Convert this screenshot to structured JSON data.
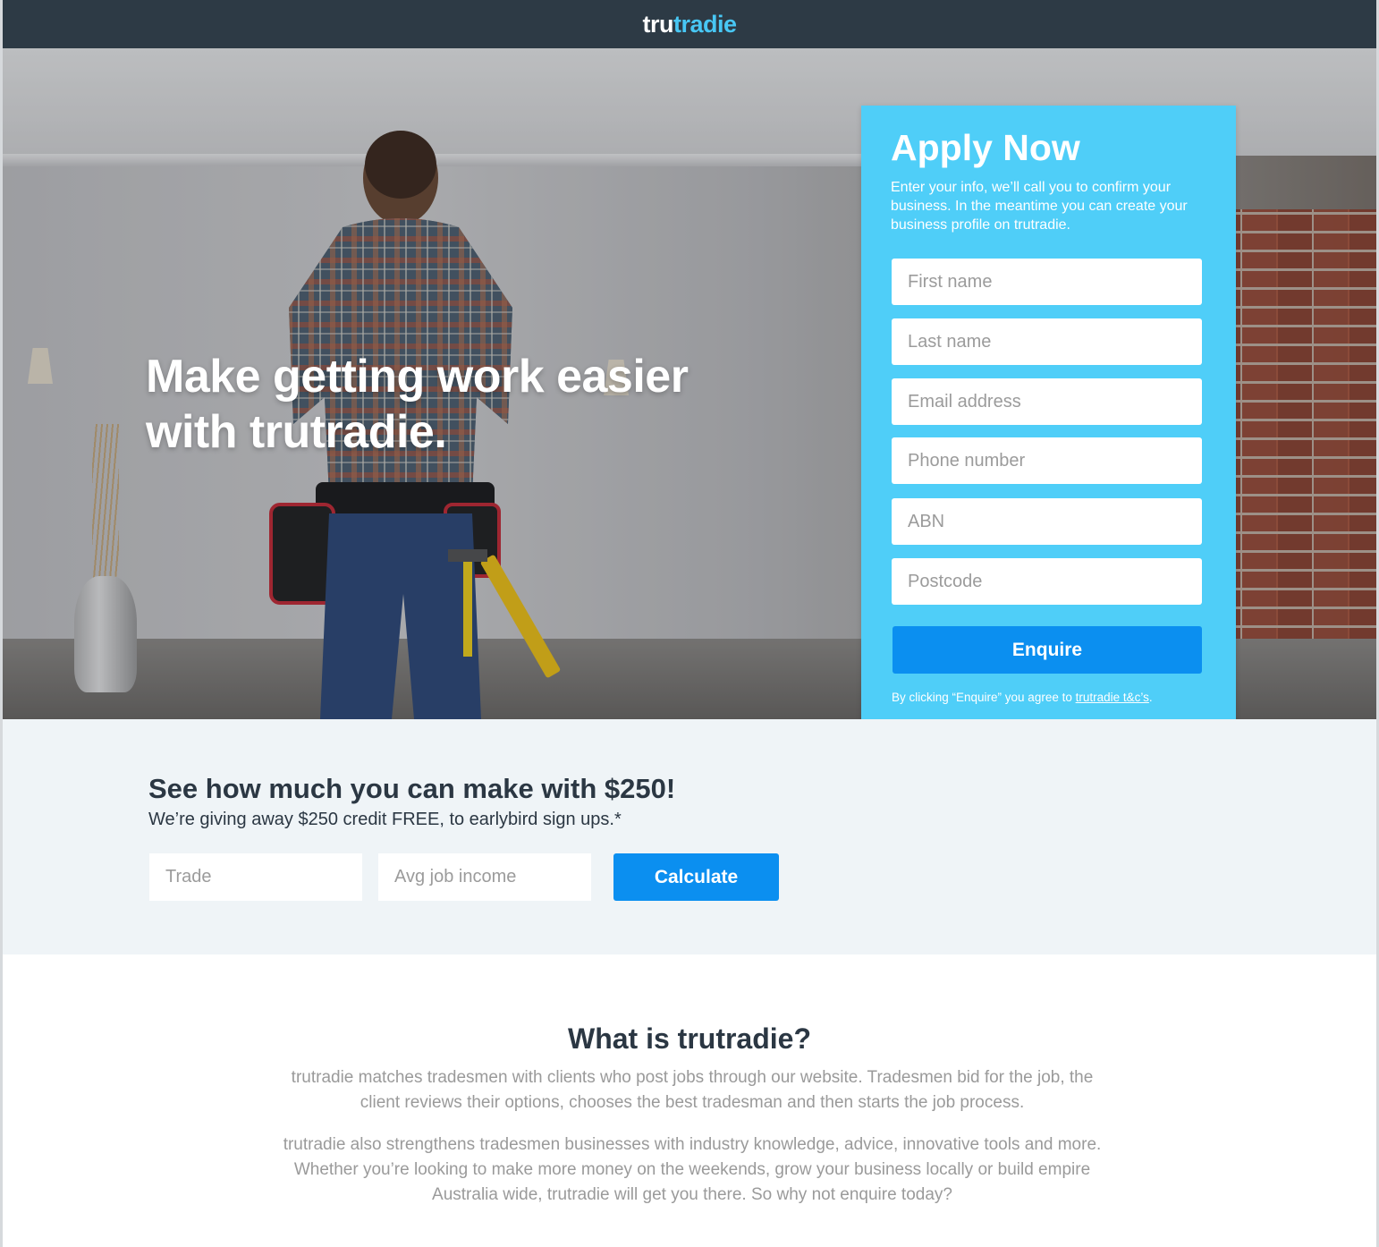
{
  "header": {
    "logo_part1": "tru",
    "logo_part2": "tradie"
  },
  "hero": {
    "headline": "Make getting work easier with trutradie."
  },
  "form": {
    "title": "Apply Now",
    "subtitle": "Enter your info, we’ll call you to confirm your business. In the meantime you can create your business profile on trutradie.",
    "fields": {
      "first_name": "First name",
      "last_name": "Last name",
      "email": "Email address",
      "phone": "Phone number",
      "abn": "ABN",
      "postcode": "Postcode"
    },
    "submit_label": "Enquire",
    "terms_prefix": "By clicking “Enquire” you agree to ",
    "terms_link": "trutradie t&c’s",
    "terms_suffix": "."
  },
  "calculator": {
    "title": "See how much you can make with $250!",
    "subtitle": "We’re giving away $250 credit FREE, to earlybird sign ups.*",
    "trade_placeholder": "Trade",
    "income_placeholder": "Avg job income",
    "button_label": "Calculate"
  },
  "about": {
    "title": "What is trutradie?",
    "paragraph1": "trutradie matches tradesmen with clients who post jobs through our website. Tradesmen bid for the job, the client reviews their options, chooses the best tradesman and then starts the job process.",
    "paragraph2": "trutradie also strengthens tradesmen businesses with industry knowledge, advice, innovative tools and more. Whether you’re looking to make more money on the weekends, grow your business locally or build empire Australia wide, trutradie will get you there. So why not enquire today?"
  },
  "colors": {
    "header_bg": "#2d3a45",
    "brand_accent": "#48c7f4",
    "form_bg": "#4fcef8",
    "button_blue": "#0b8ff0",
    "calc_bg": "#eff4f7"
  }
}
